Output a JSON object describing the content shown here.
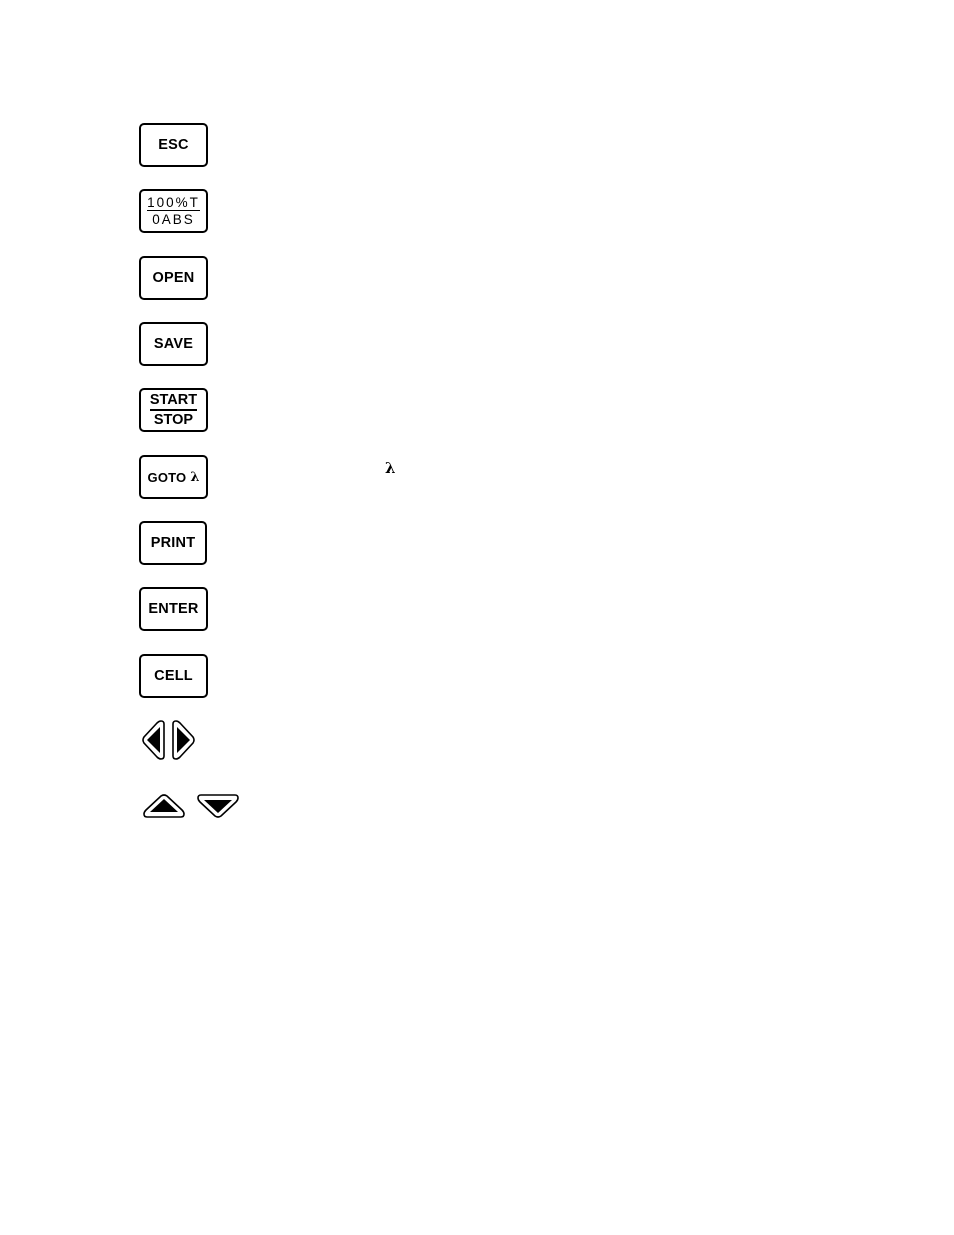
{
  "keys": {
    "esc": "ESC",
    "percent_t": "100%T",
    "zero_abs": "0ABS",
    "open": "OPEN",
    "save": "SAVE",
    "start": "START",
    "stop": "STOP",
    "goto": "GOTO",
    "goto_symbol": "λ",
    "print": "PRINT",
    "enter": "ENTER",
    "cell": "CELL"
  },
  "arrows": {
    "left": "left-arrow-key",
    "right": "right-arrow-key",
    "up": "up-arrow-key",
    "down": "down-arrow-key"
  },
  "text": {
    "lambda_symbol": "λ"
  }
}
